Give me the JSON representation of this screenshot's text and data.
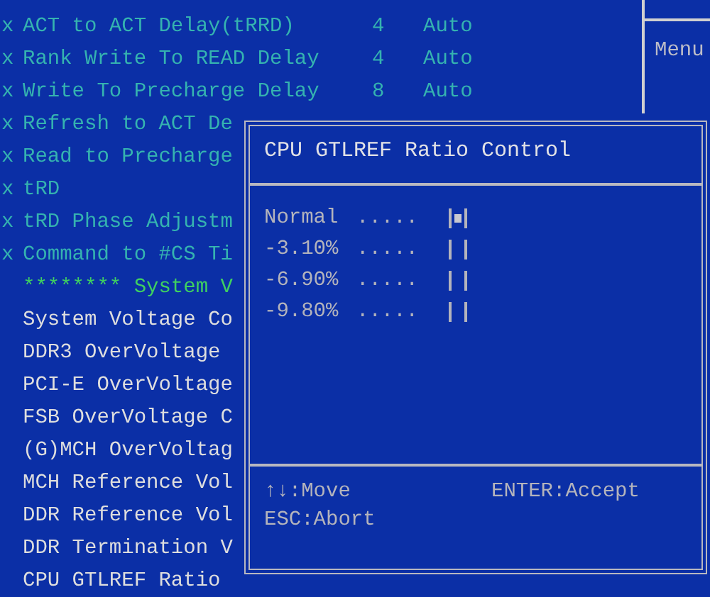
{
  "settings": [
    {
      "kind": "locked",
      "marker": "x",
      "label": "ACT to ACT Delay(tRRD)",
      "value": "4",
      "mode": "Auto"
    },
    {
      "kind": "locked",
      "marker": "x",
      "label": "Rank Write To READ Delay",
      "value": "4",
      "mode": "Auto"
    },
    {
      "kind": "locked",
      "marker": "x",
      "label": "Write To Precharge Delay",
      "value": "8",
      "mode": "Auto"
    },
    {
      "kind": "locked",
      "marker": "x",
      "label": "Refresh to ACT De"
    },
    {
      "kind": "locked",
      "marker": "x",
      "label": "Read to Precharge"
    },
    {
      "kind": "locked",
      "marker": "x",
      "label": "tRD"
    },
    {
      "kind": "locked",
      "marker": "x",
      "label": "tRD Phase Adjustm"
    },
    {
      "kind": "locked",
      "marker": "x",
      "label": "Command to #CS Ti"
    },
    {
      "kind": "header",
      "label": "******** System V"
    },
    {
      "kind": "option",
      "label": "System Voltage Co"
    },
    {
      "kind": "option",
      "label": "DDR3 OverVoltage"
    },
    {
      "kind": "option",
      "label": "PCI-E OverVoltage"
    },
    {
      "kind": "option",
      "label": "FSB OverVoltage C"
    },
    {
      "kind": "option",
      "label": "(G)MCH OverVoltag"
    },
    {
      "kind": "option",
      "label": "MCH Reference Vol"
    },
    {
      "kind": "option",
      "label": "DDR Reference Vol"
    },
    {
      "kind": "option",
      "label": "DDR Termination V"
    },
    {
      "kind": "option",
      "label": "CPU GTLREF Ratio"
    }
  ],
  "help_panel": {
    "title": "Menu"
  },
  "dialog": {
    "title": "CPU GTLREF Ratio Control",
    "options": [
      {
        "label": "Normal",
        "dots": ".....",
        "selected": true
      },
      {
        "label": "-3.10%",
        "dots": ".....",
        "selected": false
      },
      {
        "label": "-6.90%",
        "dots": ".....",
        "selected": false
      },
      {
        "label": "-9.80%",
        "dots": ".....",
        "selected": false
      }
    ],
    "hints": [
      "↑↓:Move",
      "ENTER:Accept",
      "ESC:Abort"
    ]
  }
}
